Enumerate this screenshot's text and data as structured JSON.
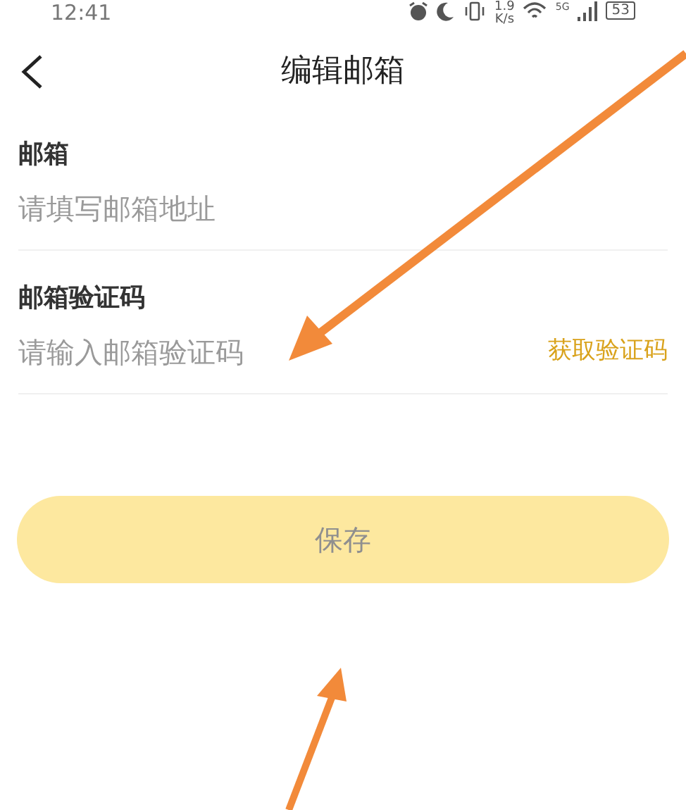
{
  "status_bar": {
    "time": "12:41",
    "speed_value": "1.9",
    "speed_unit": "K/s",
    "network_type": "5G",
    "battery": "53"
  },
  "header": {
    "title": "编辑邮箱"
  },
  "fields": [
    {
      "label": "邮箱",
      "placeholder": "请填写邮箱地址"
    },
    {
      "label": "邮箱验证码",
      "placeholder": "请输入邮箱验证码",
      "action": "获取验证码"
    }
  ],
  "save_button": {
    "label": "保存",
    "disabled": true
  }
}
